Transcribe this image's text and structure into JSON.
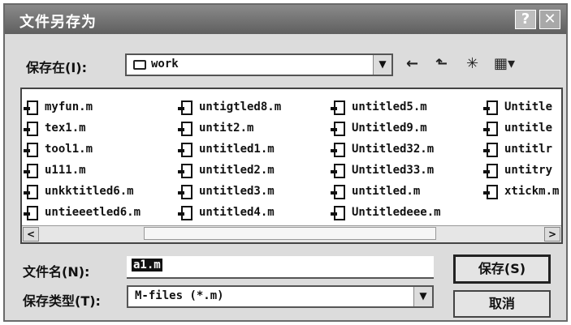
{
  "window": {
    "title": "文件另存为",
    "help_glyph": "?",
    "close_glyph": "✕"
  },
  "savein": {
    "label": "保存在(I):",
    "value": "work",
    "arrow": "▼"
  },
  "toolbar": {
    "back": "←",
    "up": "⬑",
    "newfolder": "✳",
    "views": "▦▾"
  },
  "files": {
    "col1": [
      "myfun.m",
      "tex1.m",
      "tool1.m",
      "u111.m",
      "unkktitled6.m",
      "untieeetled6.m"
    ],
    "col2": [
      "untigtled8.m",
      "untit2.m",
      "untitled1.m",
      "untitled2.m",
      "untitled3.m",
      "untitled4.m"
    ],
    "col3": [
      "untitled5.m",
      "Untitled9.m",
      "Untitled32.m",
      "Untitled33.m",
      "untitled.m",
      "Untitledeee.m"
    ],
    "col4": [
      "Untitle",
      "untitle",
      "untitlr",
      "untitry",
      "xtickm.m"
    ]
  },
  "scroll": {
    "left": "<",
    "right": ">"
  },
  "filename": {
    "label": "文件名(N):",
    "value": "a1.m"
  },
  "filetype": {
    "label": "保存类型(T):",
    "value": "M-files (*.m)",
    "arrow": "▼"
  },
  "buttons": {
    "save": "保存(S)",
    "cancel": "取消"
  }
}
